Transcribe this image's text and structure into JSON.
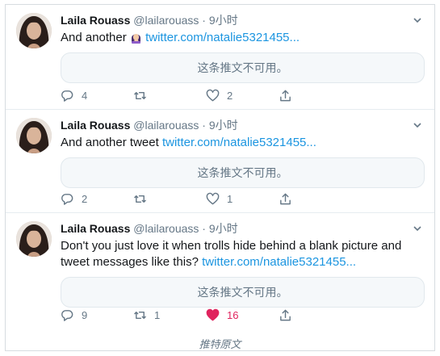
{
  "tweets": [
    {
      "name": "Laila Rouass",
      "handle": "@lailarouass",
      "separator": "·",
      "time": "9小时",
      "text": "And another",
      "emoji": "woman-facepalming-emoji",
      "link": "twitter.com/natalie5321455...",
      "card_text": "这条推文不可用。",
      "replies": "4",
      "retweets": "",
      "likes": "2",
      "liked": false
    },
    {
      "name": "Laila Rouass",
      "handle": "@lailarouass",
      "separator": "·",
      "time": "9小时",
      "text": "And another tweet",
      "link": "twitter.com/natalie5321455...",
      "card_text": "这条推文不可用。",
      "replies": "2",
      "retweets": "",
      "likes": "1",
      "liked": false
    },
    {
      "name": "Laila Rouass",
      "handle": "@lailarouass",
      "separator": "·",
      "time": "9小时",
      "text": "Don't you just love it when trolls hide behind a blank picture and tweet messages like this?",
      "link": "twitter.com/natalie5321455...",
      "card_text": "这条推文不可用。",
      "replies": "9",
      "retweets": "1",
      "likes": "16",
      "liked": true
    }
  ],
  "footer": {
    "label": "推特原文"
  },
  "colors": {
    "link": "#1b95e0",
    "like_active": "#e0245e",
    "muted": "#657786"
  }
}
